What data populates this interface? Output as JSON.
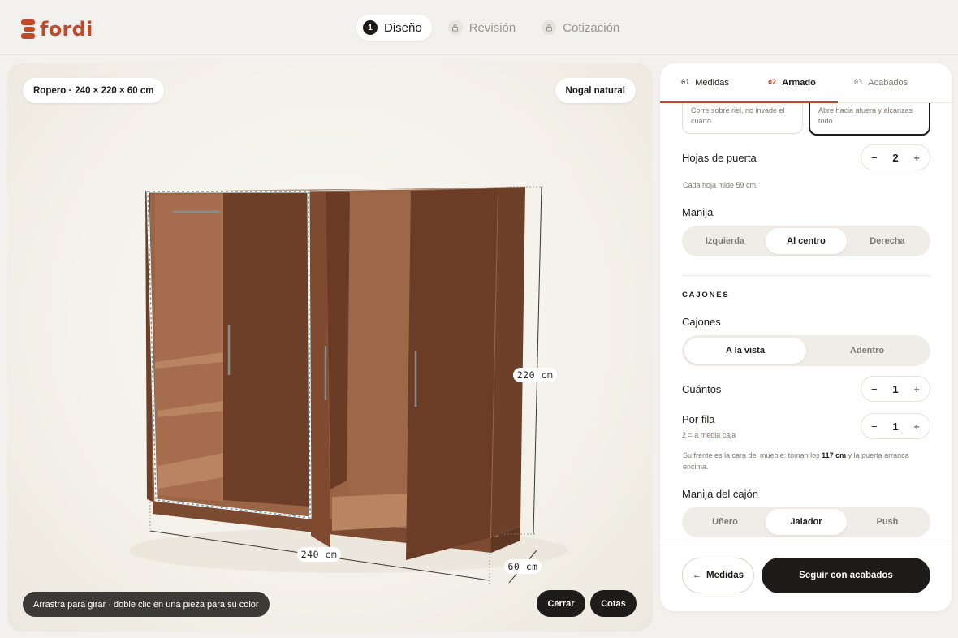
{
  "brand": {
    "name": "fordi"
  },
  "steps": [
    {
      "num": "1",
      "label": "Diseño"
    },
    {
      "label": "Revisión"
    },
    {
      "label": "Cotización"
    }
  ],
  "viewer": {
    "product_name": "Ropero ·",
    "dims_text": "240 × 220 × 60 cm",
    "finish": "Nogal natural",
    "hint": "Arrastra para girar · doble clic en una pieza para su color",
    "close_label": "Cerrar",
    "cotas_label": "Cotas",
    "dim_width": "240 cm",
    "dim_height": "220 cm",
    "dim_depth": "60 cm"
  },
  "panel": {
    "tabs": [
      {
        "num": "01",
        "label": "Medidas"
      },
      {
        "num": "02",
        "label": "Armado"
      },
      {
        "num": "03",
        "label": "Acabados"
      }
    ],
    "door_options": [
      {
        "desc": "Corre sobre riel, no invade el cuarto"
      },
      {
        "desc": "Abre hacia afuera y alcanzas todo"
      }
    ],
    "door_leaves_label": "Hojas de puerta",
    "door_leaves_value": "2",
    "door_leaves_note": "Cada hoja mide 59 cm.",
    "handle_label": "Manija",
    "handle_options": [
      "Izquierda",
      "Al centro",
      "Derecha"
    ],
    "drawers_section": "CAJONES",
    "drawers_label": "Cajones",
    "drawers_options": [
      "A la vista",
      "Adentro"
    ],
    "count_label": "Cuántos",
    "count_value": "1",
    "per_row_label": "Por fila",
    "per_row_sub": "2 = a media caja",
    "per_row_value": "1",
    "front_note_a": "Su frente es la cara del mueble: toman los",
    "front_note_b": "117 cm",
    "front_note_c": "y la puerta arranca encima.",
    "drawer_handle_label": "Manija del cajón",
    "drawer_handle_options": [
      "Uñero",
      "Jalador",
      "Push"
    ],
    "back_label": "Medidas",
    "next_label": "Seguir con acabados",
    "minus": "−",
    "plus": "+"
  },
  "colors": {
    "accent": "#c0492b",
    "dark": "#1e1c1a",
    "wood": "#7a4a2f"
  }
}
